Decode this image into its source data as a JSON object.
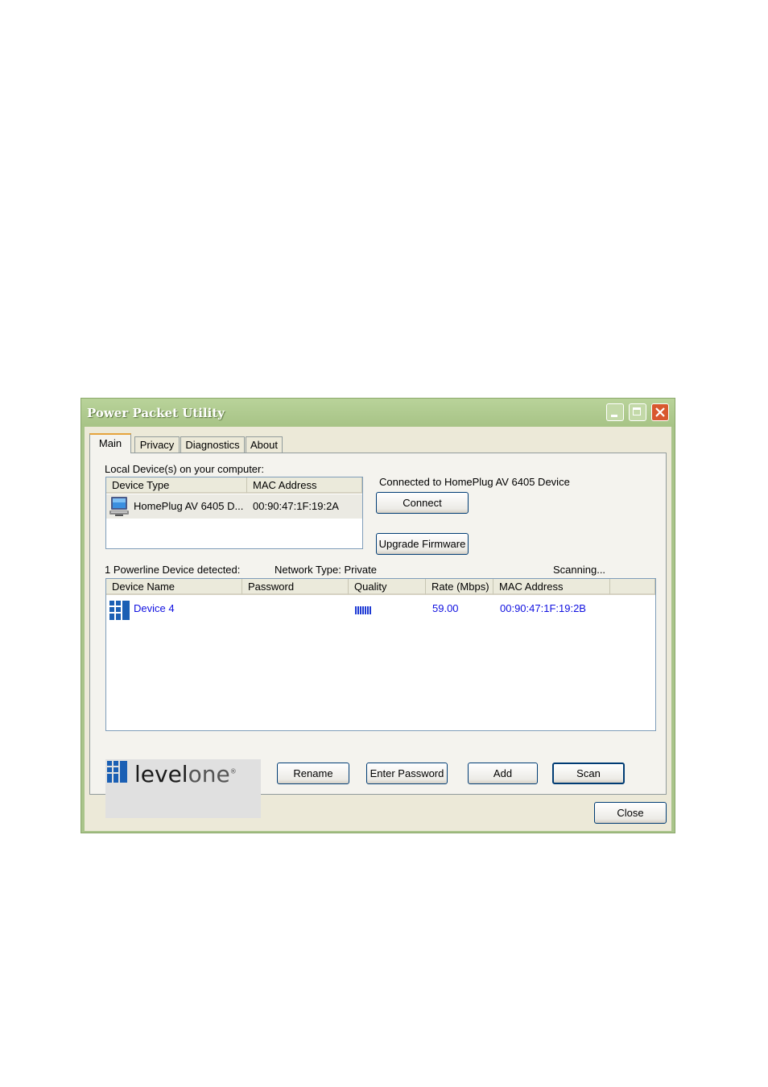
{
  "window": {
    "title": "Power Packet Utility"
  },
  "tabs": [
    {
      "label": "Main",
      "active": true
    },
    {
      "label": "Privacy",
      "active": false
    },
    {
      "label": "Diagnostics",
      "active": false
    },
    {
      "label": "About",
      "active": false
    }
  ],
  "local": {
    "heading": "Local Device(s) on your computer:",
    "columns": [
      "Device Type",
      "MAC Address"
    ],
    "rows": [
      {
        "device_type": "HomePlug AV 6405 D...",
        "mac": "00:90:47:1F:19:2A",
        "icon": "computer-icon"
      }
    ],
    "connected_text": "Connected to HomePlug AV 6405 Device",
    "connect_label": "Connect",
    "upgrade_label": "Upgrade Firmware"
  },
  "status": {
    "detected": "1 Powerline Device detected:",
    "network_type": "Network Type: Private",
    "scanning": "Scanning..."
  },
  "remote": {
    "columns": [
      "Device Name",
      "Password",
      "Quality",
      "Rate (Mbps)",
      "MAC Address"
    ],
    "rows": [
      {
        "name": "Device 4",
        "password": "",
        "quality_bars": 7,
        "rate": "59.00",
        "mac": "00:90:47:1F:19:2B",
        "icon": "levelone-device-icon"
      }
    ]
  },
  "logo": {
    "brand_a": "level",
    "brand_b": "one"
  },
  "buttons": {
    "rename": "Rename",
    "enter_password": "Enter Password",
    "add": "Add",
    "scan": "Scan",
    "close": "Close"
  },
  "colors": {
    "link_blue": "#1010e0",
    "titlebar": "#a9c48a",
    "close": "#d8582f"
  }
}
